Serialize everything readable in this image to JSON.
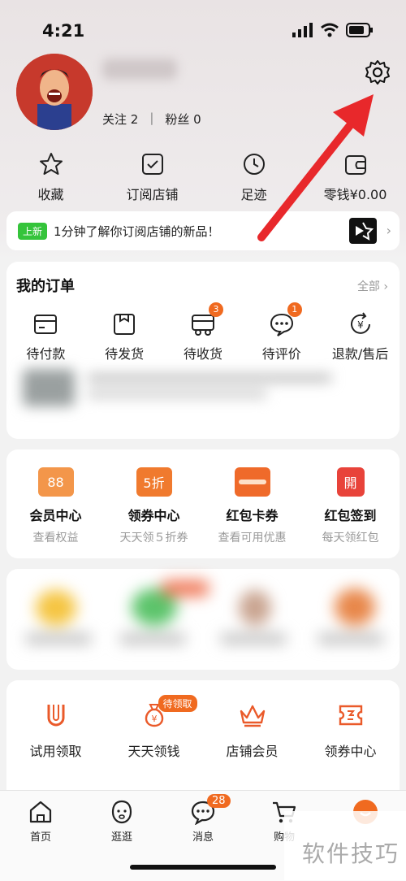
{
  "status": {
    "time": "4:21"
  },
  "profile": {
    "following": "关注 2",
    "separator": "|",
    "fans": "粉丝 0"
  },
  "quick": [
    {
      "label": "收藏",
      "icon": "star-icon"
    },
    {
      "label": "订阅店铺",
      "icon": "store-check-icon"
    },
    {
      "label": "足迹",
      "icon": "clock-icon"
    },
    {
      "label": "零钱¥0.00",
      "icon": "wallet-icon"
    }
  ],
  "banner": {
    "badge": "上新",
    "text": "1分钟了解你订阅店铺的新品！",
    "chevron": "›"
  },
  "orders": {
    "title": "我的订单",
    "all": "全部 ›",
    "items": [
      {
        "label": "待付款",
        "icon": "card-icon",
        "badge": ""
      },
      {
        "label": "待发货",
        "icon": "box-icon",
        "badge": ""
      },
      {
        "label": "待收货",
        "icon": "truck-icon",
        "badge": "3"
      },
      {
        "label": "待评价",
        "icon": "comment-icon",
        "badge": "1"
      },
      {
        "label": "退款/售后",
        "icon": "refund-icon",
        "badge": ""
      }
    ]
  },
  "member": [
    {
      "title": "会员中心",
      "sub": "查看权益",
      "icon_text": "88",
      "color": "#f3964a"
    },
    {
      "title": "领券中心",
      "sub": "天天领５折券",
      "icon_text": "5折",
      "color": "#f07a2e"
    },
    {
      "title": "红包卡券",
      "sub": "查看可用优惠",
      "icon_text": "",
      "color": "#ef6a2a"
    },
    {
      "title": "红包签到",
      "sub": "每天领红包",
      "icon_text": "開",
      "color": "#e8433a"
    }
  ],
  "tools": [
    {
      "label": "试用领取",
      "icon": "u-icon",
      "badge": ""
    },
    {
      "label": "天天领钱",
      "icon": "money-bag-icon",
      "badge": "待领取"
    },
    {
      "label": "店铺会员",
      "icon": "crown-icon",
      "badge": ""
    },
    {
      "label": "领券中心",
      "icon": "ticket-icon",
      "badge": ""
    }
  ],
  "tabbar": [
    {
      "label": "首页",
      "icon": "home-icon",
      "badge": ""
    },
    {
      "label": "逛逛",
      "icon": "browse-icon",
      "badge": ""
    },
    {
      "label": "消息",
      "icon": "message-icon",
      "badge": "28"
    },
    {
      "label": "购物",
      "icon": "cart-icon",
      "badge": ""
    }
  ],
  "watermark": "软件技巧",
  "colors": {
    "accent": "#f06a20",
    "arrow": "#e8282b"
  }
}
